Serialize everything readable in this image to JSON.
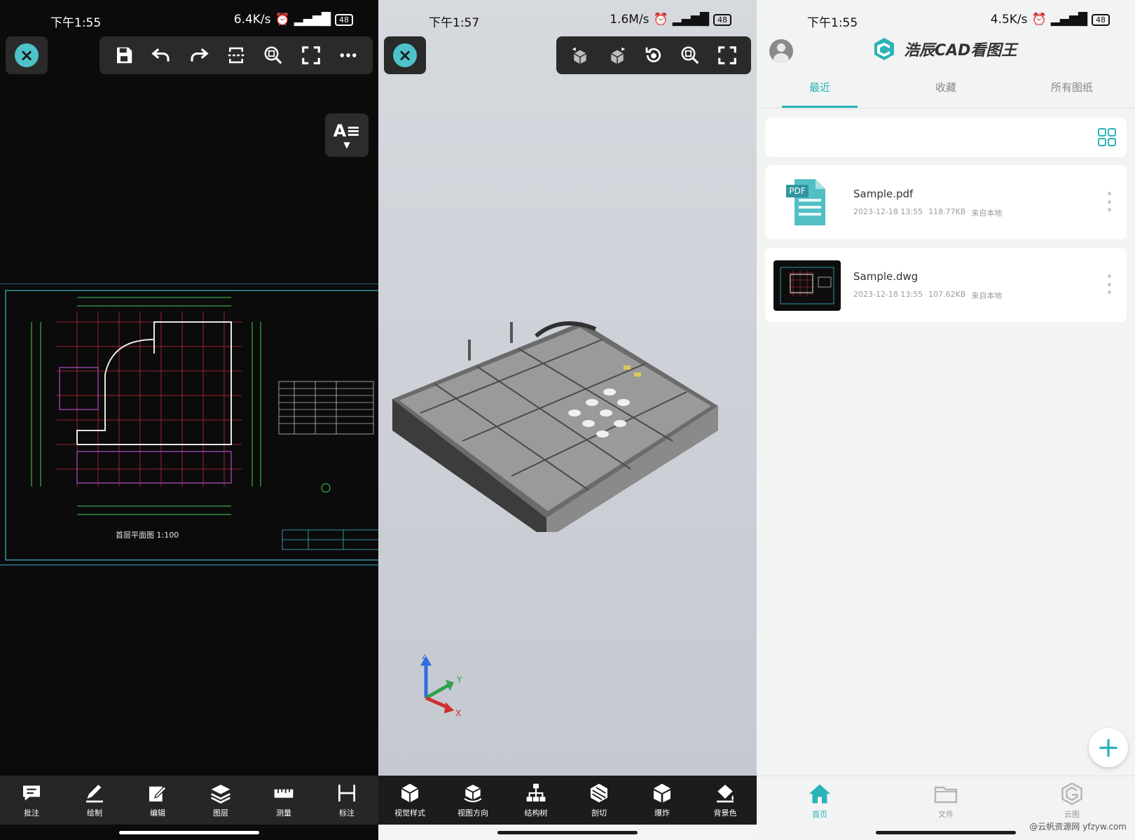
{
  "viewer2d": {
    "status": {
      "time": "下午1:55",
      "speed": "6.4K/s",
      "battery": "48"
    },
    "toolbar": {
      "icons": [
        "close-icon",
        "save-icon",
        "undo-icon",
        "redo-icon",
        "section-icon",
        "zoom-extents-icon",
        "fullscreen-icon",
        "more-icon"
      ]
    },
    "text_style_label": "A≡",
    "drawing": {
      "title": "首层平面图  1:100"
    },
    "bottom_tools": [
      {
        "label": "批注",
        "icon": "comment-icon"
      },
      {
        "label": "绘制",
        "icon": "pencil-icon"
      },
      {
        "label": "编辑",
        "icon": "edit-icon"
      },
      {
        "label": "图层",
        "icon": "layers-icon"
      },
      {
        "label": "测量",
        "icon": "ruler-icon"
      },
      {
        "label": "标注",
        "icon": "dimension-icon"
      }
    ]
  },
  "viewer3d": {
    "status": {
      "time": "下午1:57",
      "speed": "1.6M/s",
      "battery": "48"
    },
    "toolbar": {
      "icons": [
        "close-icon",
        "cube-rotate-left-icon",
        "cube-rotate-right-icon",
        "reset-view-icon",
        "zoom-extents-icon",
        "fullscreen-icon"
      ]
    },
    "axes": {
      "z": "Z",
      "y": "Y",
      "x": "X"
    },
    "bottom_tools": [
      {
        "label": "视觉样式",
        "icon": "visual-style-icon"
      },
      {
        "label": "视图方向",
        "icon": "view-direction-icon"
      },
      {
        "label": "结构树",
        "icon": "structure-tree-icon"
      },
      {
        "label": "剖切",
        "icon": "section-cut-icon"
      },
      {
        "label": "爆炸",
        "icon": "explode-icon"
      },
      {
        "label": "背景色",
        "icon": "background-color-icon"
      }
    ]
  },
  "home": {
    "status": {
      "time": "下午1:55",
      "speed": "4.5K/s",
      "battery": "48"
    },
    "app_name": "浩辰CAD看图王",
    "tabs": [
      {
        "label": "最近",
        "active": true
      },
      {
        "label": "收藏",
        "active": false
      },
      {
        "label": "所有图纸",
        "active": false
      }
    ],
    "files": [
      {
        "name": "Sample.pdf",
        "date": "2023-12-18 13:55",
        "size": "118.77KB",
        "source": "来自本地",
        "thumb_label": "PDF"
      },
      {
        "name": "Sample.dwg",
        "date": "2023-12-18 13:55",
        "size": "107.62KB",
        "source": "来自本地"
      }
    ],
    "nav": [
      {
        "label": "首页",
        "active": true,
        "icon": "home-icon"
      },
      {
        "label": "文件",
        "active": false,
        "icon": "folder-icon"
      },
      {
        "label": "云图",
        "active": false,
        "icon": "cloud-logo-icon"
      }
    ],
    "watermark": "@云帆资源网 yfzyw.com",
    "accent": "#2bb3b8"
  }
}
